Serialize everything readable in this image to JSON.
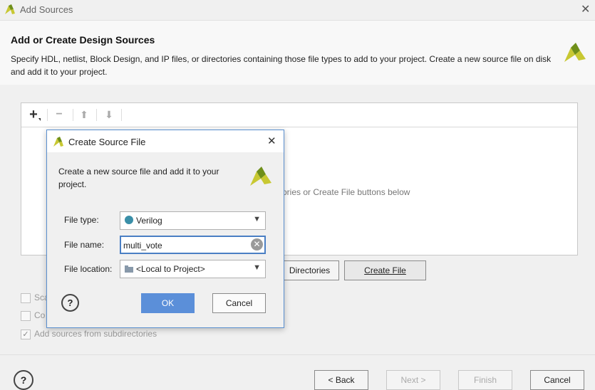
{
  "window": {
    "title": "Add Sources",
    "close_glyph": "✕"
  },
  "header": {
    "title": "Add or Create Design Sources",
    "description": "Specify HDL, netlist, Block Design, and IP files, or directories containing those file types to add to your project. Create a new source file on disk and add it to your project."
  },
  "toolbar": {
    "add_glyph": "+",
    "remove_glyph": "−",
    "up_glyph": "⬆",
    "down_glyph": "⬇",
    "icons": [
      "add-icon",
      "remove-icon",
      "move-up-icon",
      "move-down-icon"
    ]
  },
  "panel": {
    "hint_text": "ories or Create File buttons below"
  },
  "buttons": {
    "add_directories_label": "Directories",
    "create_file_label": "Create File"
  },
  "options": {
    "scan_label": "Sca",
    "copy_label": "Co",
    "subdirs_label": "Add sources from subdirectories",
    "subdirs_checked": true
  },
  "footer": {
    "help_glyph": "?",
    "back_label": "< Back",
    "next_label": "Next >",
    "finish_label": "Finish",
    "cancel_label": "Cancel"
  },
  "dialog": {
    "title": "Create Source File",
    "close_glyph": "✕",
    "description": "Create a new source file and add it to your project.",
    "file_type_label": "File type:",
    "file_type_value": "Verilog",
    "file_name_label": "File name:",
    "file_name_value": "multi_vote",
    "file_location_label": "File location:",
    "file_location_value": "<Local to Project>",
    "help_glyph": "?",
    "ok_label": "OK",
    "cancel_label": "Cancel"
  },
  "colors": {
    "accent": "#5b8fd9",
    "dialog_border": "#5a8fcf",
    "verilog_dot": "#3a8fa8",
    "logo_yellow": "#c8c832",
    "logo_green": "#6f8f1a"
  }
}
